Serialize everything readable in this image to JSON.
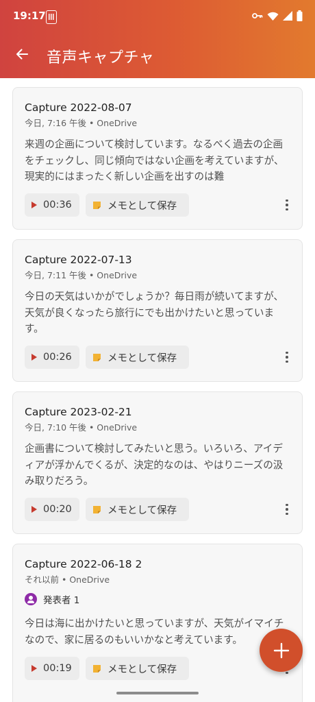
{
  "status_bar": {
    "time": "19:17"
  },
  "header": {
    "title": "音声キャプチャ"
  },
  "captures": [
    {
      "title": "Capture 2022-08-07",
      "meta": "今日, 7:16 午後 • OneDrive",
      "text": "来週の企画について検討しています。なるべく過去の企画をチェックし、同じ傾向ではない企画を考えていますが、現実的にはまったく新しい企画を出すのは難",
      "duration": "00:36",
      "save_label": "メモとして保存"
    },
    {
      "title": "Capture 2022-07-13",
      "meta": "今日, 7:11 午後 • OneDrive",
      "text": "今日の天気はいかがでしょうか？毎日雨が続いてますが、天気が良くなったら旅行にでも出かけたいと思っています。",
      "duration": "00:26",
      "save_label": "メモとして保存"
    },
    {
      "title": "Capture 2023-02-21",
      "meta": "今日, 7:10 午後 • OneDrive",
      "text": "企画書について検討してみたいと思う。いろいろ、アイディアが浮かんでくるが、決定的なのは、やはりニーズの汲み取りだろう。",
      "duration": "00:20",
      "save_label": "メモとして保存"
    },
    {
      "title": "Capture 2022-06-18 2",
      "meta": "それ以前 • OneDrive",
      "speaker": "発表者 1",
      "text": "今日は海に出かけたいと思っていますが、天気がイマイチなので、家に居るのもいいかなと考えています。",
      "duration": "00:19",
      "save_label": "メモとして保存"
    }
  ],
  "colors": {
    "header_start": "#d0433f",
    "header_end": "#e27a2e",
    "accent": "#c63a2e",
    "fab": "#d14f2b",
    "note_icon": "#f2b233",
    "speaker_avatar": "#8e2ba7"
  },
  "icons": {
    "back": "arrow-left-icon",
    "play": "play-icon",
    "save": "sticky-note-icon",
    "more": "more-vertical-icon",
    "fab": "plus-icon"
  }
}
